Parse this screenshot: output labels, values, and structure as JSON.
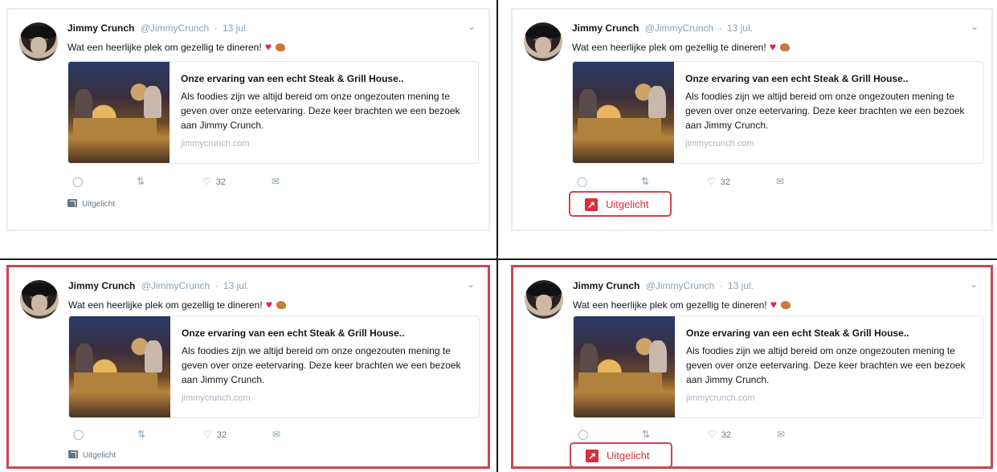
{
  "panels": [
    {
      "id": "top-left",
      "author_name": "Jimmy Crunch",
      "author_handle": "@JimmyCrunch",
      "dot": "·",
      "date": "13 jul.",
      "text": "Wat een heerlijke plek om gezellig te dineren!",
      "heart": "♥",
      "card_title": "Onze ervaring van een echt Steak & Grill House..",
      "card_desc": "Als foodies zijn we altijd bereid om onze ongezouten mening te geven over onze eetervaring. Deze keer brachten we een bezoek aan Jimmy Crunch.",
      "card_url": "jimmycrunch.com",
      "likes": "32",
      "featured_label": "Uitgelicht",
      "featured_style": "small",
      "highlighted": false
    },
    {
      "id": "top-right",
      "author_name": "Jimmy Crunch",
      "author_handle": "@JimmyCrunch",
      "dot": "·",
      "date": "13 jul.",
      "text": "Wat een heerlijke plek om gezellig te dineren!",
      "heart": "♥",
      "card_title": "Onze ervaring van een echt Steak & Grill House..",
      "card_desc": "Als foodies zijn we altijd bereid om onze ongezouten mening te geven over onze eetervaring. Deze keer brachten we een bezoek aan Jimmy Crunch.",
      "card_url": "jimmycrunch.com",
      "likes": "32",
      "featured_label": "Uitgelicht",
      "featured_style": "boxed",
      "highlighted": false
    },
    {
      "id": "bottom-left",
      "author_name": "Jimmy Crunch",
      "author_handle": "@JimmyCrunch",
      "dot": "·",
      "date": "13 jul.",
      "text": "Wat een heerlijke plek om gezellig te dineren!",
      "heart": "♥",
      "card_title": "Onze ervaring van een echt Steak & Grill House..",
      "card_desc": "Als foodies zijn we altijd bereid om onze ongezouten mening te geven over onze eetervaring. Deze keer brachten we een bezoek aan Jimmy Crunch.",
      "card_url": "jimmycrunch.com",
      "likes": "32",
      "featured_label": "Uitgelicht",
      "featured_style": "small",
      "highlighted": true
    },
    {
      "id": "bottom-right",
      "author_name": "Jimmy Crunch",
      "author_handle": "@JimmyCrunch",
      "dot": "·",
      "date": "13 jul.",
      "text": "Wat een heerlijke plek om gezellig te dineren!",
      "heart": "♥",
      "card_title": "Onze ervaring van een echt Steak & Grill House..",
      "card_desc": "Als foodies zijn we altijd bereid om onze ongezouten mening te geven over onze eetervaring. Deze keer brachten we een bezoek aan Jimmy Crunch.",
      "card_url": "jimmycrunch.com",
      "likes": "32",
      "featured_label": "Uitgelicht",
      "featured_style": "boxed",
      "highlighted": true
    }
  ],
  "icons": {
    "reply": "reply-icon",
    "retweet": "retweet-icon",
    "like": "heart-icon",
    "dm": "envelope-icon",
    "featured": "arrow-up-right-icon",
    "chevron": "chevron-down-icon"
  },
  "colors": {
    "highlight_border": "#c9474f",
    "featured_red": "#d4303a",
    "muted": "#8aa3b5",
    "divider": "#1a1a1a"
  }
}
